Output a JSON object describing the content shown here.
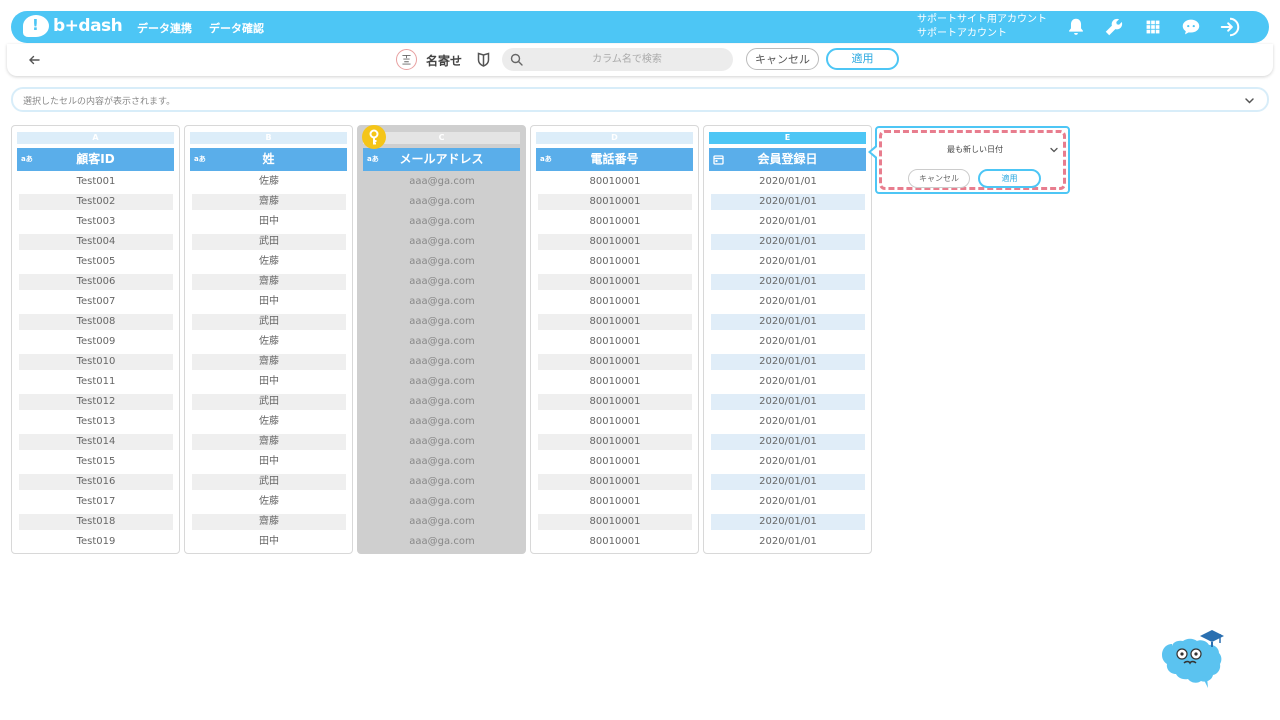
{
  "app": {
    "logo_text": "b+dash"
  },
  "nav": [
    {
      "label": "データ連携"
    },
    {
      "label": "データ確認"
    }
  ],
  "account": {
    "line1": "サポートサイト用アカウント",
    "line2": "サポートアカウント"
  },
  "toolbar": {
    "mode_label": "名寄せ",
    "search_placeholder": "カラム名で検索",
    "cancel_label": "キャンセル",
    "apply_label": "適用"
  },
  "cellbar": {
    "text": "選択したセルの内容が表示されます。"
  },
  "columns": [
    {
      "letter": "A",
      "type": "text",
      "type_badge": "aあ",
      "header": "顧客ID",
      "cells": [
        "Test001",
        "Test002",
        "Test003",
        "Test004",
        "Test005",
        "Test006",
        "Test007",
        "Test008",
        "Test009",
        "Test010",
        "Test011",
        "Test012",
        "Test013",
        "Test014",
        "Test015",
        "Test016",
        "Test017",
        "Test018",
        "Test019"
      ]
    },
    {
      "letter": "B",
      "type": "text",
      "type_badge": "aあ",
      "header": "姓",
      "cells": [
        "佐藤",
        "齋藤",
        "田中",
        "武田",
        "佐藤",
        "齋藤",
        "田中",
        "武田",
        "佐藤",
        "齋藤",
        "田中",
        "武田",
        "佐藤",
        "齋藤",
        "田中",
        "武田",
        "佐藤",
        "齋藤",
        "田中"
      ]
    },
    {
      "letter": "C",
      "type": "text",
      "type_badge": "aあ",
      "header": "メールアドレス",
      "selected": true,
      "key": true,
      "cells": [
        "aaa@ga.com",
        "aaa@ga.com",
        "aaa@ga.com",
        "aaa@ga.com",
        "aaa@ga.com",
        "aaa@ga.com",
        "aaa@ga.com",
        "aaa@ga.com",
        "aaa@ga.com",
        "aaa@ga.com",
        "aaa@ga.com",
        "aaa@ga.com",
        "aaa@ga.com",
        "aaa@ga.com",
        "aaa@ga.com",
        "aaa@ga.com",
        "aaa@ga.com",
        "aaa@ga.com",
        "aaa@ga.com"
      ]
    },
    {
      "letter": "D",
      "type": "text",
      "type_badge": "aあ",
      "header": "電話番号",
      "cells": [
        "80010001",
        "80010001",
        "80010001",
        "80010001",
        "80010001",
        "80010001",
        "80010001",
        "80010001",
        "80010001",
        "80010001",
        "80010001",
        "80010001",
        "80010001",
        "80010001",
        "80010001",
        "80010001",
        "80010001",
        "80010001",
        "80010001"
      ]
    },
    {
      "letter": "E",
      "type": "date",
      "type_badge": "",
      "header": "会員登録日",
      "active": true,
      "cells": [
        "2020/01/01",
        "2020/01/01",
        "2020/01/01",
        "2020/01/01",
        "2020/01/01",
        "2020/01/01",
        "2020/01/01",
        "2020/01/01",
        "2020/01/01",
        "2020/01/01",
        "2020/01/01",
        "2020/01/01",
        "2020/01/01",
        "2020/01/01",
        "2020/01/01",
        "2020/01/01",
        "2020/01/01",
        "2020/01/01",
        "2020/01/01"
      ]
    }
  ],
  "popup": {
    "selected_option": "最も新しい日付",
    "cancel_label": "キャンセル",
    "apply_label": "適用"
  },
  "colors": {
    "brand": "#4dc6f5",
    "header": "#5aaeea",
    "key": "#f5c518",
    "highlight": "#e87d8e"
  }
}
